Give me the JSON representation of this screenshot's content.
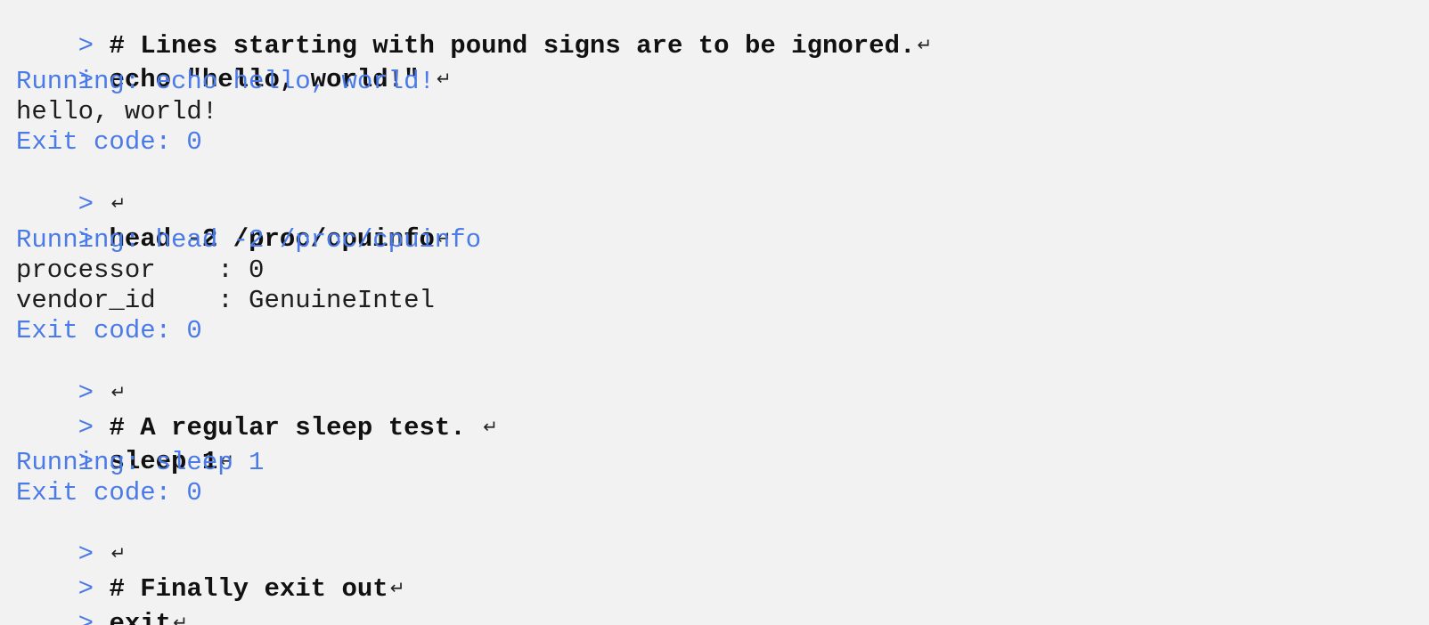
{
  "terminal": {
    "prompt_symbol": ">",
    "return_symbol": "↵",
    "colors": {
      "background": "#f2f2f2",
      "prompt": "#4a7be8",
      "info": "#4a7be8",
      "command": "#111111",
      "output": "#1e1e1e"
    },
    "lines": [
      {
        "type": "input",
        "text": "# Lines starting with pound signs are to be ignored."
      },
      {
        "type": "input",
        "text": "echo \"hello, world!\" "
      },
      {
        "type": "info",
        "text": "Running: echo hello, world!"
      },
      {
        "type": "output",
        "text": "hello, world!"
      },
      {
        "type": "info",
        "text": "Exit code: 0"
      },
      {
        "type": "input",
        "text": ""
      },
      {
        "type": "input",
        "text": "head -2 /proc/cpuinfo"
      },
      {
        "type": "info",
        "text": "Running: head -2 /proc/cpuinfo"
      },
      {
        "type": "output",
        "text": "processor    : 0"
      },
      {
        "type": "output",
        "text": "vendor_id    : GenuineIntel"
      },
      {
        "type": "info",
        "text": "Exit code: 0"
      },
      {
        "type": "input",
        "text": ""
      },
      {
        "type": "input",
        "text": "# A regular sleep test. "
      },
      {
        "type": "input",
        "text": "sleep 1"
      },
      {
        "type": "info",
        "text": "Running: sleep 1"
      },
      {
        "type": "info",
        "text": "Exit code: 0"
      },
      {
        "type": "input",
        "text": ""
      },
      {
        "type": "input",
        "text": "# Finally exit out"
      },
      {
        "type": "input",
        "text": "exit"
      }
    ]
  }
}
